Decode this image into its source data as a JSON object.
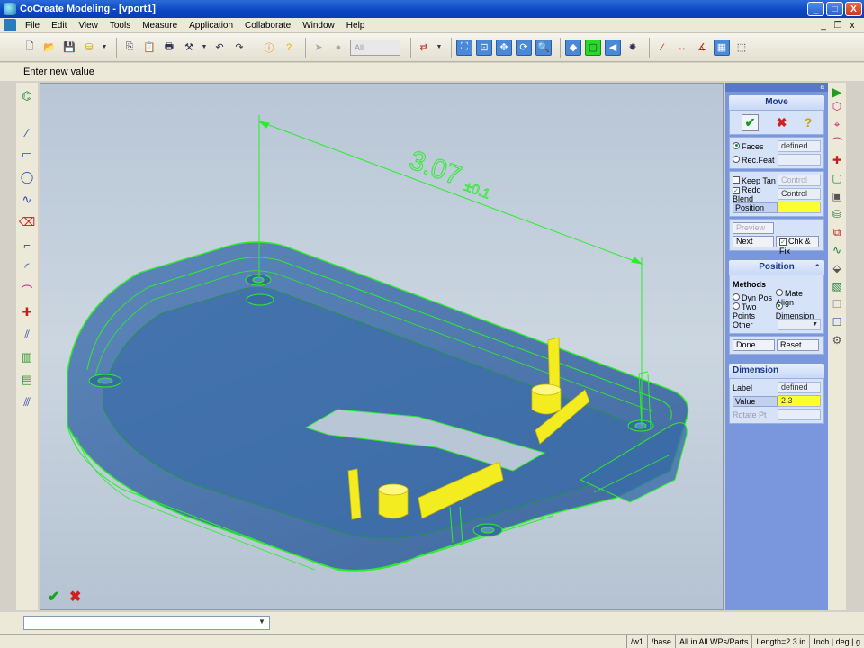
{
  "window": {
    "title": "CoCreate Modeling - [vport1]",
    "minimize": "_",
    "maximize": "□",
    "close": "X"
  },
  "menu": {
    "items": [
      "File",
      "Edit",
      "View",
      "Tools",
      "Measure",
      "Application",
      "Collaborate",
      "Window",
      "Help"
    ],
    "mdi": [
      "_",
      "❐",
      "x"
    ]
  },
  "toolbar": {
    "combo_value": "All"
  },
  "prompt": "Enter new value",
  "viewport": {
    "dimension_text": "3.07",
    "tolerance_text": "±0.1",
    "ok_label": "✔",
    "cancel_label": "✖"
  },
  "panel": {
    "corner": "a",
    "move": {
      "title": "Move",
      "faces_label": "Faces",
      "faces_value": "defined",
      "recfeat_label": "Rec.Feat",
      "keeptan_label": "Keep Tan",
      "keeptan_value": "Control",
      "redoblend_label": "Redo Blend",
      "redoblend_value": "Control",
      "position_label": "Position",
      "preview_label": "Preview",
      "next_label": "Next",
      "chkfix_label": "Chk & Fix"
    },
    "position": {
      "title": "Position",
      "methods_label": "Methods",
      "dynpos_label": "Dyn Pos",
      "matealign_label": "Mate Align",
      "twopoints_label": "Two Points",
      "dimension_label": "Dimension",
      "other_label": "Other",
      "done_label": "Done",
      "reset_label": "Reset"
    },
    "dimension": {
      "title": "Dimension",
      "label_label": "Label",
      "label_value": "defined",
      "value_label": "Value",
      "value_value": "2.3",
      "rotatept_label": "Rotate Pt"
    }
  },
  "command": {
    "value": ""
  },
  "status": {
    "cells": [
      "/w1",
      "/base",
      "All in All WPs/Parts",
      "Length=2.3 in",
      "Inch | deg | g"
    ]
  },
  "colors": {
    "title_blue": "#0a46c4",
    "panel_blue": "#7a96dc",
    "wire_green": "#22ee22",
    "highlight_yellow": "#ffff30"
  }
}
